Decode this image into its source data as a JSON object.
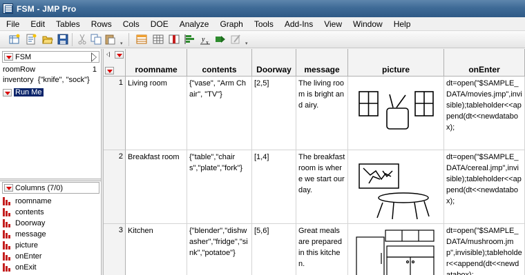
{
  "window": {
    "title": "FSM - JMP Pro"
  },
  "menu": [
    "File",
    "Edit",
    "Tables",
    "Rows",
    "Cols",
    "DOE",
    "Analyze",
    "Graph",
    "Tools",
    "Add-Ins",
    "View",
    "Window",
    "Help"
  ],
  "toolbar": {
    "buttons": [
      "new-table-icon",
      "new-script-icon",
      "open-icon",
      "save-icon",
      "cut-icon",
      "copy-icon",
      "paste-icon",
      "data-table-icon",
      "table-icon",
      "columns-icon",
      "distribution-icon",
      "fit-model-icon",
      "graph-builder-icon",
      "script-editor-icon"
    ]
  },
  "table_panel": {
    "name": "FSM",
    "table_vars": [
      {
        "name": "roomRow",
        "value": "1"
      },
      {
        "name": "inventory",
        "value": "{\"knife\", \"sock\"}"
      }
    ],
    "script": "Run Me"
  },
  "columns_panel": {
    "header": "Columns (7/0)",
    "items": [
      "roomname",
      "contents",
      "Doorway",
      "message",
      "picture",
      "onEnter",
      "onExit"
    ]
  },
  "grid": {
    "headers": [
      "roomname",
      "contents",
      "Doorway",
      "message",
      "picture",
      "onEnter"
    ],
    "rows": [
      {
        "num": "1",
        "roomname": "Living room",
        "contents": "{\"vase\", \"Arm Chair\", \"TV\"}",
        "doorway": "[2,5]",
        "message": "The living room is bright and airy.",
        "picture": "living-room-sketch",
        "onEnter": "dt=open(\"$SAMPLE_DATA/movies.jmp\",invisible);tableholder<<append(dt<<newdatabox);"
      },
      {
        "num": "2",
        "roomname": "Breakfast room",
        "contents": "{\"table\",\"chairs\",\"plate\",\"fork\"}",
        "doorway": "[1,4]",
        "message": "The breakfast room is where we start our day.",
        "picture": "breakfast-room-sketch",
        "onEnter": "dt=open(\"$SAMPLE_DATA/cereal.jmp\",invisible);tableholder<<append(dt<<newdatabox);"
      },
      {
        "num": "3",
        "roomname": "Kitchen",
        "contents": "{\"blender\",\"dishwasher\",\"fridge\",\"sink\",\"potatoe\"}",
        "doorway": "[5,6]",
        "message": "Great meals are prepared in this kitchen.",
        "picture": "kitchen-sketch",
        "onEnter": "dt=open(\"$SAMPLE_DATA/mushroom.jmp\",invisible);tableholder<<append(dt<<newdatabox);"
      }
    ]
  }
}
